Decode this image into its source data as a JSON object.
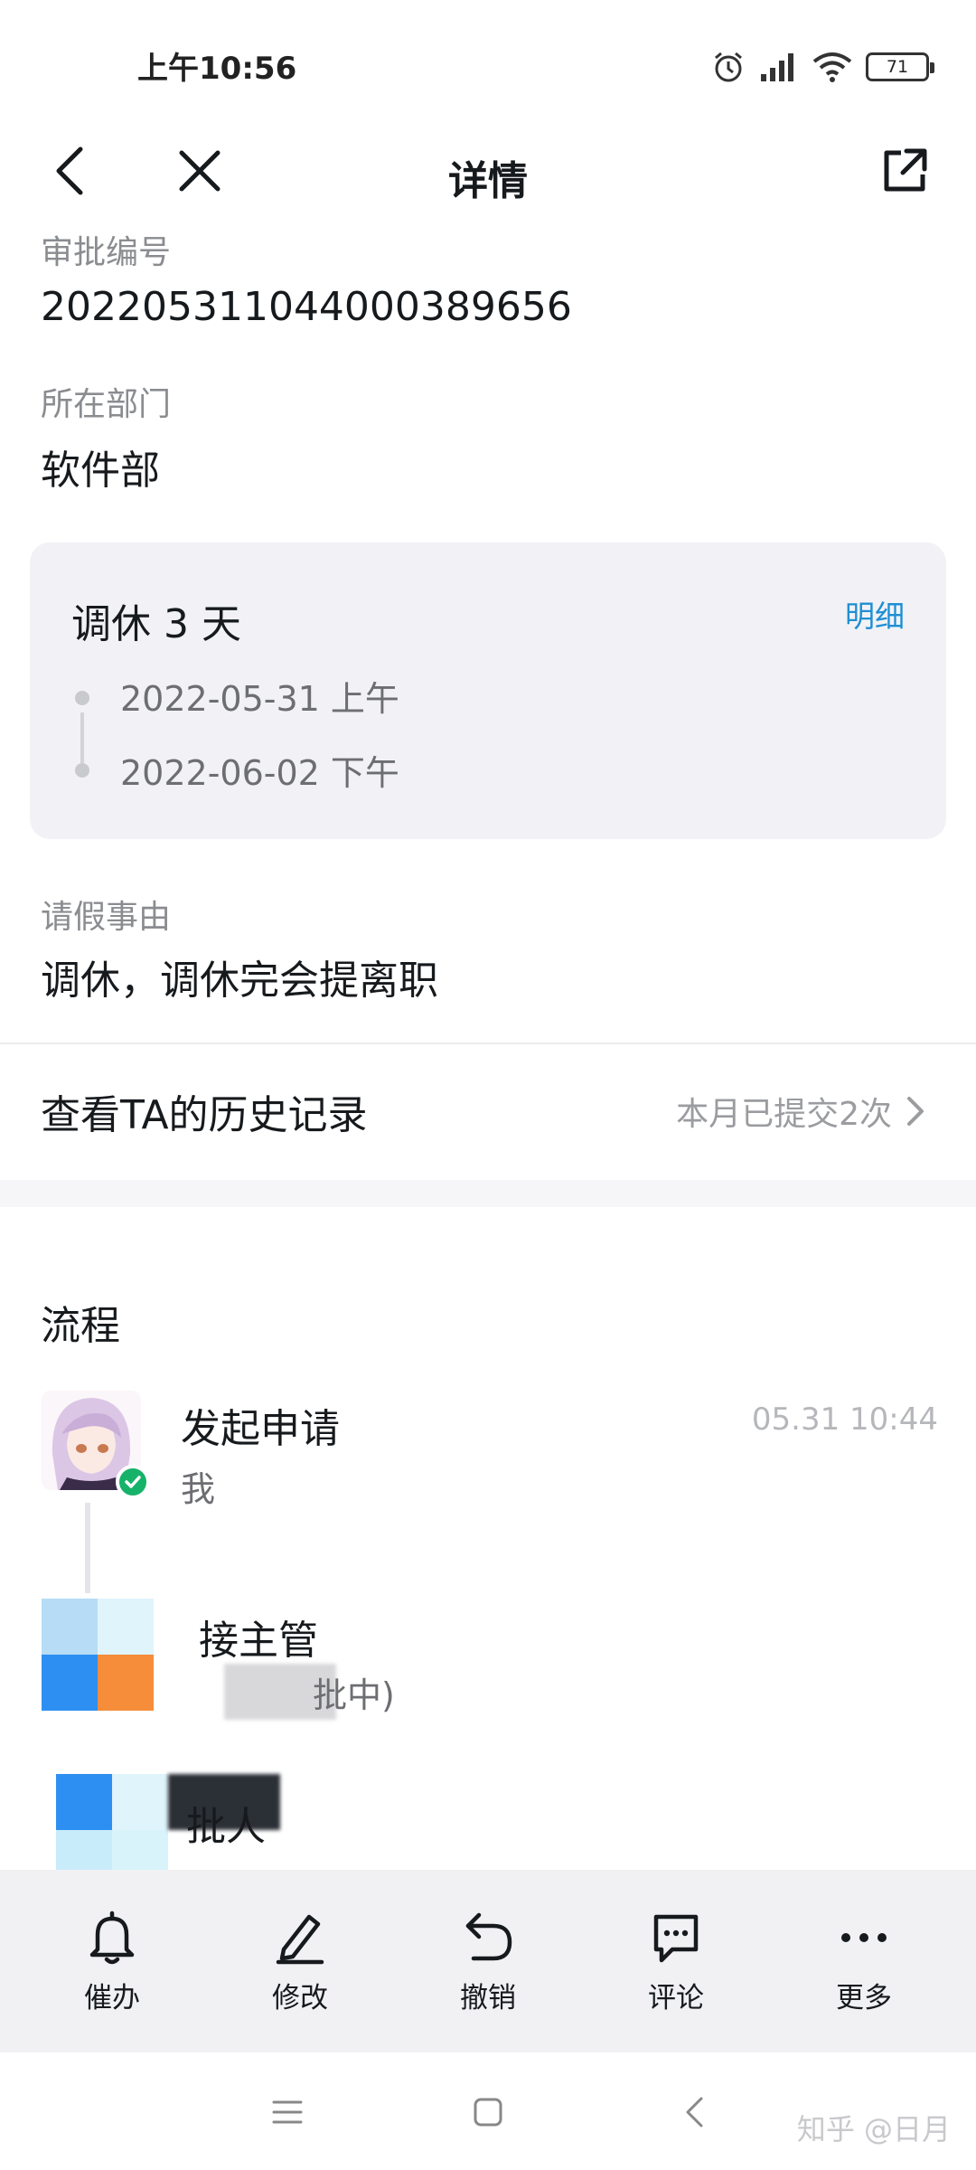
{
  "status_bar": {
    "time": "上午10:56",
    "battery": "71",
    "icons": [
      "alarm-icon",
      "signal-icon",
      "wifi-icon",
      "battery-icon"
    ]
  },
  "header": {
    "title": "详情",
    "icons": [
      "back-icon",
      "close-icon",
      "share-icon"
    ]
  },
  "fields": {
    "approval_no_label": "审批编号",
    "approval_no": "202205311044000389656",
    "dept_label": "所在部门",
    "dept": "软件部",
    "reason_label": "请假事由",
    "reason": "调休，调休完会提离职"
  },
  "leave": {
    "type": "调休 3 天",
    "detail_link": "明细",
    "start": "2022-05-31 上午",
    "end": "2022-06-02 下午"
  },
  "history": {
    "label": "查看TA的历史记录",
    "count": "本月已提交2次"
  },
  "flow": {
    "section_title": "流程",
    "steps": [
      {
        "title": "发起申请",
        "sub": "我",
        "time": "05.31 10:44"
      },
      {
        "title": "接主管",
        "sub": "批中)",
        "time": ""
      },
      {
        "title": "批人",
        "sub": "",
        "time": ""
      }
    ]
  },
  "toolbar": {
    "items": [
      {
        "label": "催办",
        "icon": "bell-icon"
      },
      {
        "label": "修改",
        "icon": "pencil-icon"
      },
      {
        "label": "撤销",
        "icon": "undo-icon"
      },
      {
        "label": "评论",
        "icon": "comment-icon"
      },
      {
        "label": "更多",
        "icon": "more-icon"
      }
    ]
  },
  "nav": {
    "watermark": "知乎 @日月",
    "icons": [
      "menu-icon",
      "home-icon",
      "back-nav-icon"
    ]
  },
  "colors": {
    "accent": "#1e8fd3",
    "success": "#17b26a",
    "card_bg": "#f2f2f6",
    "toolbar_bg": "#f1f1f4"
  }
}
